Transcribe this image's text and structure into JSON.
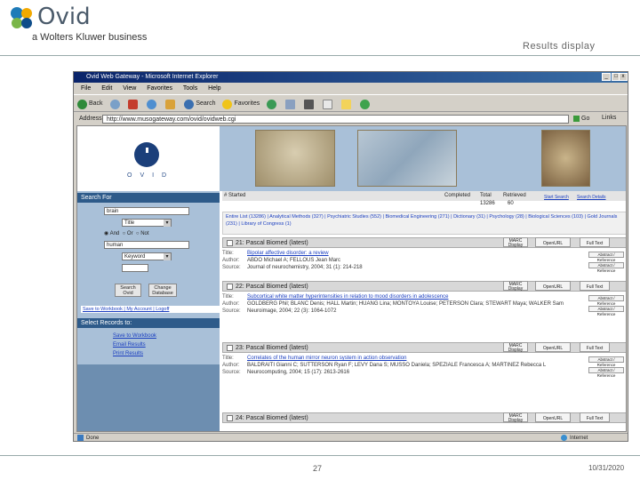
{
  "slide": {
    "brand": "Ovid",
    "tagline": "a Wolters Kluwer business",
    "title": "Results display",
    "page_number": "27",
    "date": "10/31/2020"
  },
  "browser": {
    "title": "Ovid Web Gateway - Microsoft Internet Explorer",
    "menu": [
      "File",
      "Edit",
      "View",
      "Favorites",
      "Tools",
      "Help"
    ],
    "toolbar": [
      "Back",
      "Search",
      "Favorites",
      "History"
    ],
    "address_label": "Address",
    "address_value": "http://www.musogateway.com/ovid/ovidweb.cgi",
    "go_label": "Go",
    "links_label": "Links",
    "status_left": "Done",
    "status_right": "Internet"
  },
  "ovid_page": {
    "logo_letters": "OVID",
    "search_for": {
      "header": "Search For",
      "term1": "brain",
      "field1": "Title",
      "op_and": "And",
      "op_or": "Or",
      "op_not": "Not",
      "term2": "human",
      "field2": "Keyword",
      "search_btn": "Search Ovid",
      "change_btn": "Change Database"
    },
    "work_link": "Save to Workbook  |  My Account  |  Logoff",
    "select_records": {
      "header": "Select Records to:",
      "links": [
        "Save to Workbook",
        "Email Results",
        "Print Results"
      ]
    },
    "results_header": {
      "label": "# Started",
      "completed": "Completed",
      "total_label": "Total",
      "retrieved_label": "Retrieved",
      "total": "13286",
      "retrieved": "60",
      "btn1": "Start Search",
      "btn2": "Search Details"
    },
    "facets": "Entire List (13286) | Analytical Methods (327) | Psychiatric Studies (552) | Biomedical Engineering (271) | Dictionary (31) | Psychology (28) | Biological Sciences (103) | Gold Journals (231) | Library of Congress (1)",
    "records": [
      {
        "num": "21: Pascal Biomed (latest)",
        "title": "Bipolar affective disorder: a review",
        "authors": "ABDO Michael A; FELLOUS Jean Marc",
        "source": "Journal of neurochemistry, 2004; 31 (1): 214-218",
        "marc": "MARC Display",
        "openurl": "OpenURL",
        "fulltext": "Full Text"
      },
      {
        "num": "22: Pascal Biomed (latest)",
        "title": "Subcortical white matter hyperintensities in relation to mood disorders in adolescence",
        "authors": "GOLDBERG Phil; BLANC Denis; HALL Martin; HUANG Lina; MONTOYA Louise; PETERSON Clara; STEWART Maya; WALKER Sam",
        "source": "Neuroimage, 2004; 22 (3): 1064-1072",
        "marc": "MARC Display",
        "openurl": "OpenURL",
        "fulltext": "Full Text"
      },
      {
        "num": "23: Pascal Biomed (latest)",
        "title": "Correlates of the human mirror neuron system in action observation",
        "authors": "BALDRAITI Gianni C; SUTTERSON Ryan F; LEVY Dana S; MUSSO Daniela; SPEZIALE Francesca A; MARTINEZ Rebecca L",
        "source": "Neurocomputing, 2004; 15 (17): 2613-2616",
        "marc": "MARC Display",
        "openurl": "OpenURL",
        "fulltext": "Full Text"
      },
      {
        "num": "24: Pascal Biomed (latest)",
        "marc": "MARC Display",
        "openurl": "OpenURL",
        "fulltext": "Full Text"
      }
    ],
    "labels": {
      "title": "Title:",
      "author": "Author:",
      "source": "Source:"
    },
    "abstract_btn": "Abstract / Reference"
  }
}
